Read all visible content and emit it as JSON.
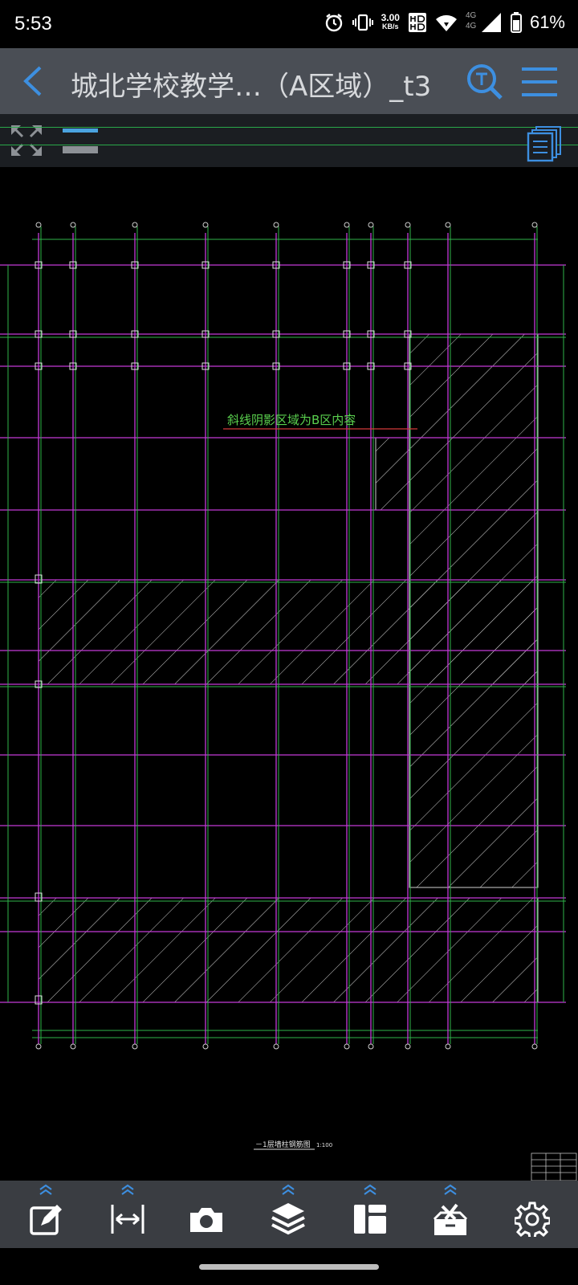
{
  "status_bar": {
    "time": "5:53",
    "net_speed_value": "3.00",
    "net_speed_unit": "KB/s",
    "signal_label_1": "4G",
    "signal_label_2": "4G",
    "battery": "61%"
  },
  "app_bar": {
    "title": "城北学校教学…（A区域）_t3"
  },
  "drawing": {
    "annotation": "斜线阴影区域为B区内容",
    "footer_title": "－1层墙柱钢筋图",
    "footer_scale": "1:100"
  },
  "colors": {
    "app_bar_bg": "#4a4e55",
    "accent": "#3d8fe0",
    "grid_magenta": "#c23ad6",
    "grid_green": "#2fb34a",
    "bottom_bar_bg": "#3a3d42"
  },
  "bottom_toolbar": {
    "icons": [
      "edit-icon",
      "measure-icon",
      "camera-icon",
      "layers-icon",
      "layout-icon",
      "toolbox-icon",
      "settings-icon"
    ]
  }
}
